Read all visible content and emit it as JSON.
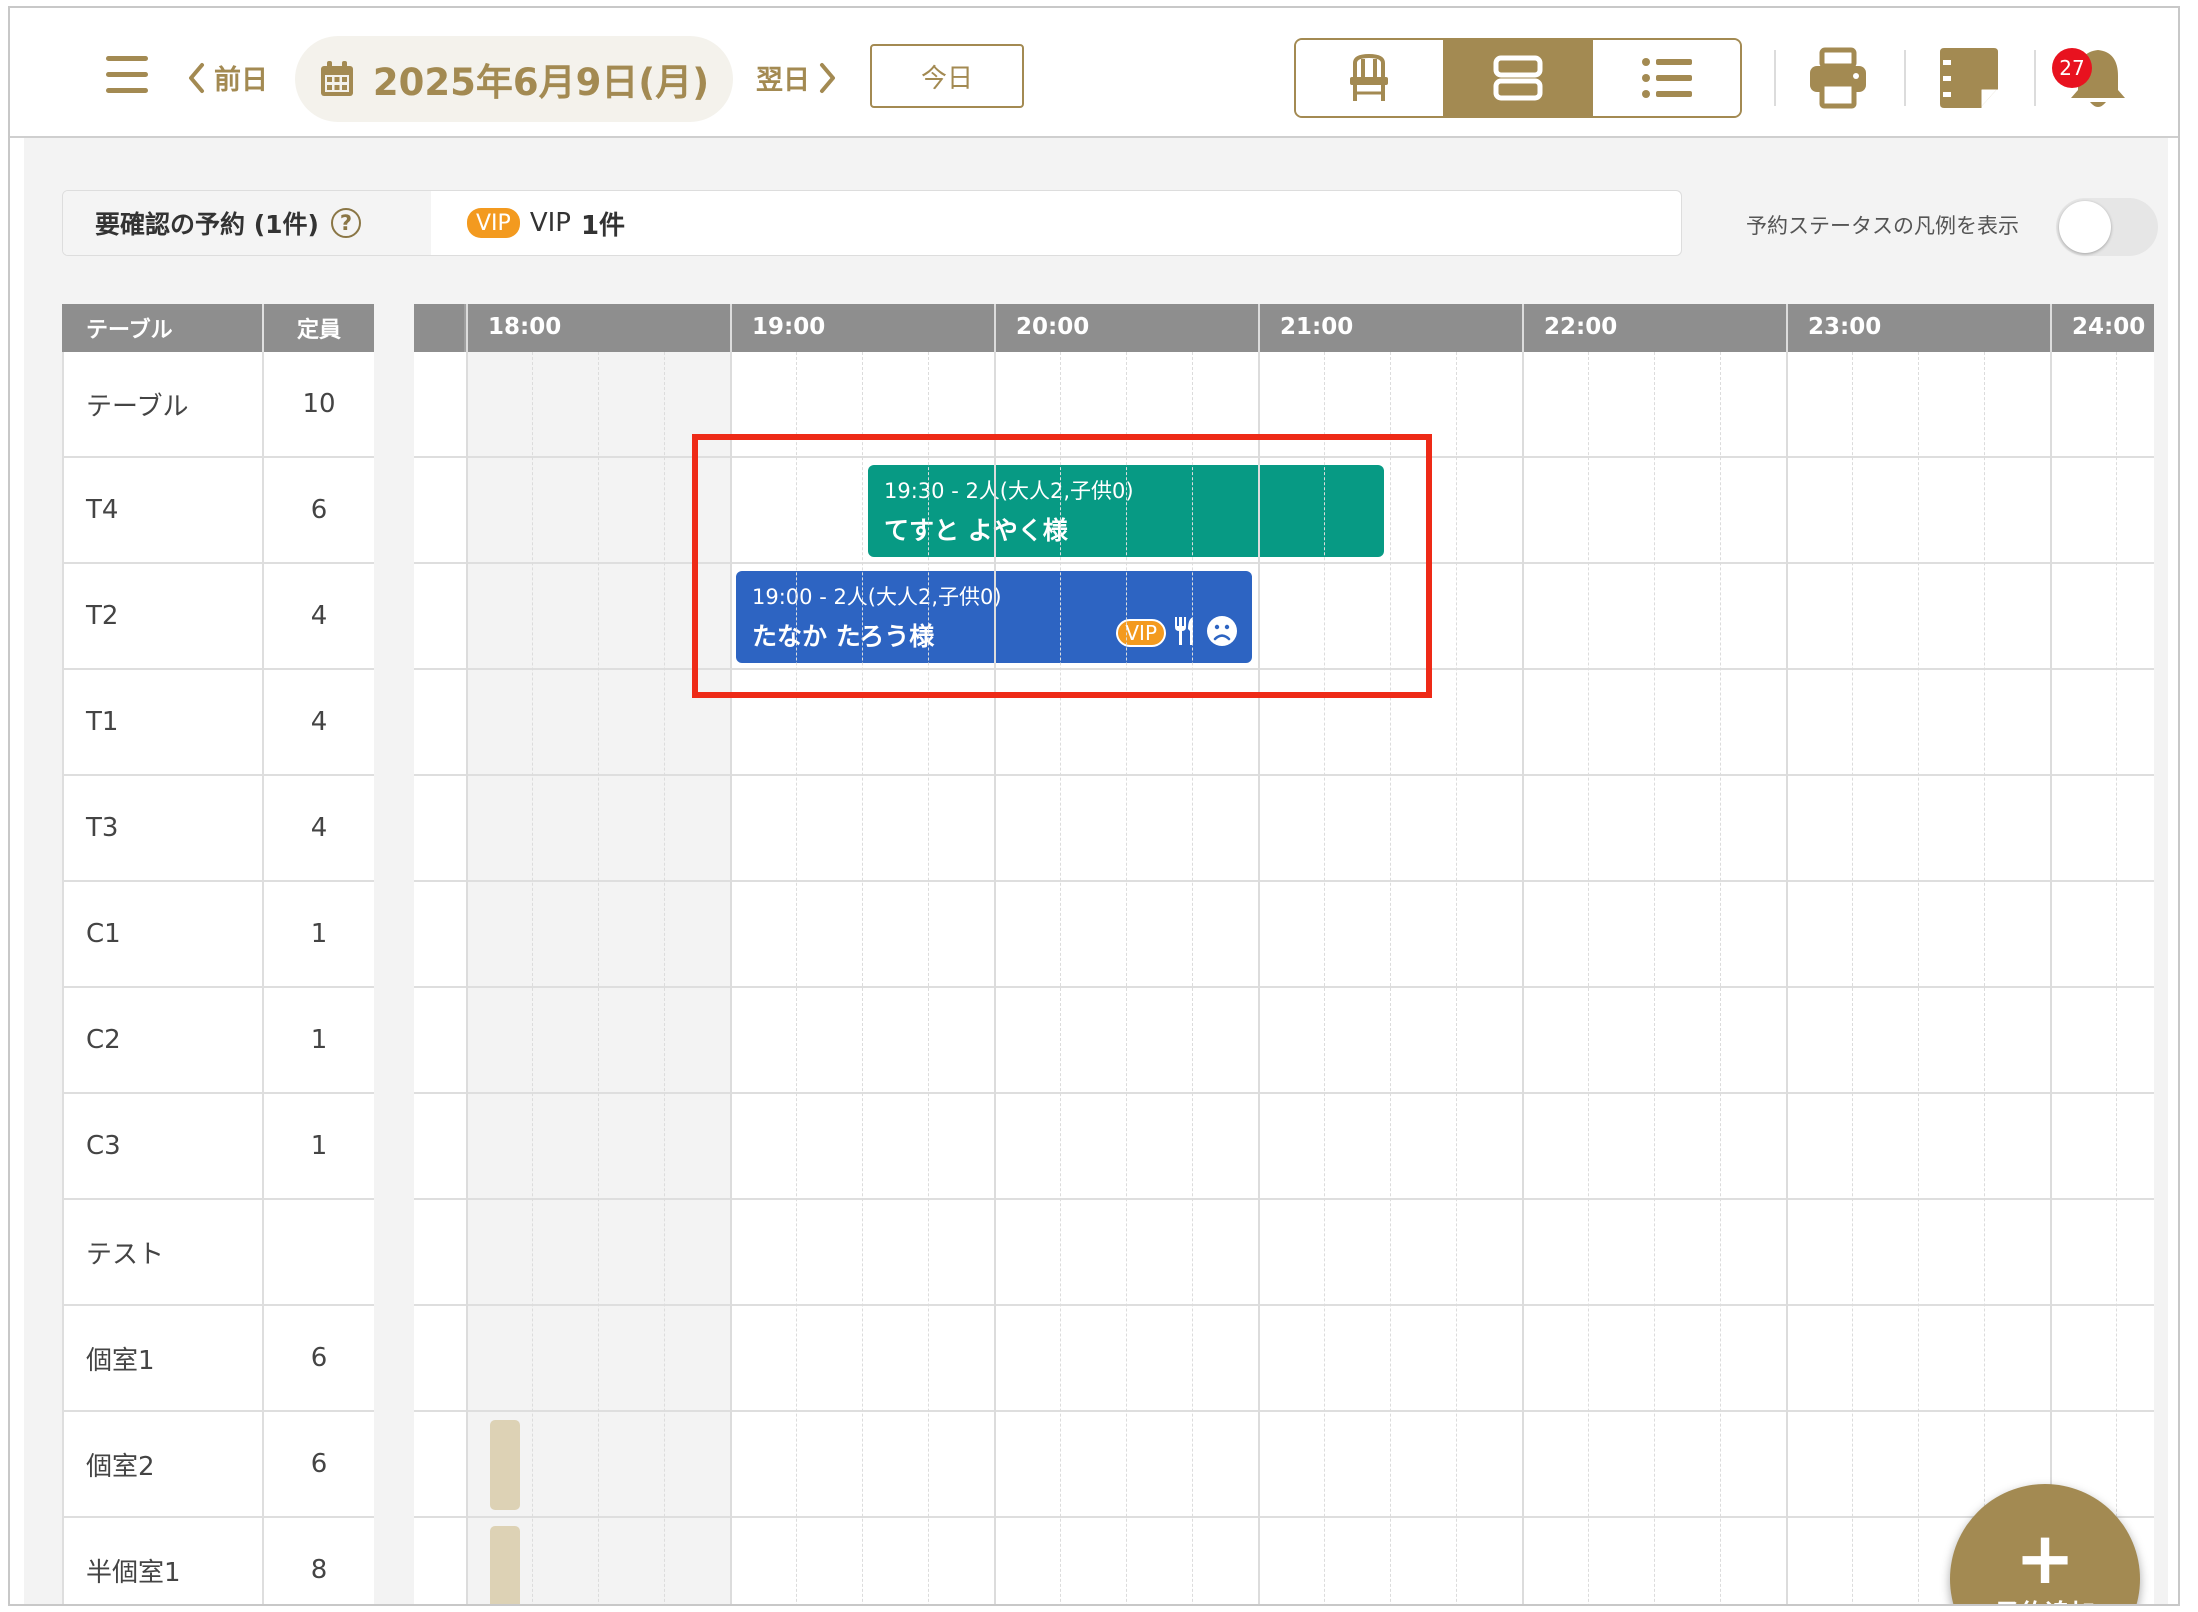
{
  "header": {
    "prev_label": "前日",
    "date_label": "2025年6月9日(月)",
    "next_label": "翌日",
    "today_label": "今日",
    "notification_count": "27"
  },
  "notice": {
    "pending_label": "要確認の予約 (1件)",
    "help_glyph": "?",
    "vip_badge": "VIP",
    "vip_text": "VIP",
    "vip_count": "1件"
  },
  "legend_toggle": {
    "label": "予約ステータスの凡例を表示",
    "on": false
  },
  "table_list": {
    "header_table": "テーブル",
    "header_capacity": "定員",
    "rows": [
      {
        "name": "テーブル",
        "capacity": "10"
      },
      {
        "name": "T4",
        "capacity": "6"
      },
      {
        "name": "T2",
        "capacity": "4"
      },
      {
        "name": "T1",
        "capacity": "4"
      },
      {
        "name": "T3",
        "capacity": "4"
      },
      {
        "name": "C1",
        "capacity": "1"
      },
      {
        "name": "C2",
        "capacity": "1"
      },
      {
        "name": "C3",
        "capacity": "1"
      },
      {
        "name": "テスト",
        "capacity": ""
      },
      {
        "name": "個室1",
        "capacity": "6"
      },
      {
        "name": "個室2",
        "capacity": "6"
      },
      {
        "name": "半個室1",
        "capacity": "8"
      }
    ]
  },
  "timeline": {
    "hours": [
      "18:00",
      "19:00",
      "20:00",
      "21:00",
      "22:00",
      "23:00",
      "24:00"
    ]
  },
  "reservations": [
    {
      "time": "19:30 - 2人(大人2,子供0)",
      "name": "てすと よやく様",
      "table": "T4",
      "color": "#079a84"
    },
    {
      "time": "19:00 - 2人(大人2,子供0)",
      "name": "たなか たろう様",
      "table": "T2",
      "color": "#2d64c2",
      "vip": "VIP"
    }
  ],
  "fab": {
    "plus": "+",
    "label": "予約追加"
  },
  "colors": {
    "accent": "#a38a52",
    "vip": "#f39a1f",
    "badge": "#e8121f",
    "highlight": "#ee2a17"
  }
}
